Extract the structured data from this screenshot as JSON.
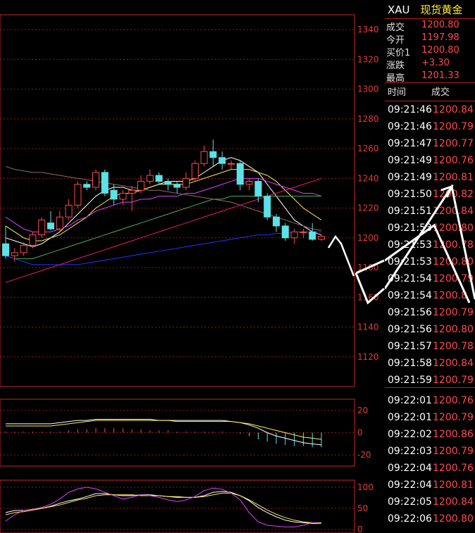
{
  "header": {
    "symbol": "XAU",
    "name": "现货黄金"
  },
  "quote": [
    {
      "label": "成交",
      "value": "1200.80"
    },
    {
      "label": "今开",
      "value": "1197.98"
    },
    {
      "label": "买价1",
      "value": "1200.80"
    },
    {
      "label": "涨跌",
      "value": "+3.30"
    },
    {
      "label": "最高",
      "value": "1201.33"
    }
  ],
  "ticks_header": {
    "time": "时间",
    "price": "成交"
  },
  "ticks": [
    {
      "time": "09:21:46",
      "price": "1200.84"
    },
    {
      "time": "09:21:46",
      "price": "1200.79"
    },
    {
      "time": "09:21:47",
      "price": "1200.77"
    },
    {
      "time": "09:21:49",
      "price": "1200.76"
    },
    {
      "time": "09:21:49",
      "price": "1200.81"
    },
    {
      "time": "09:21:50",
      "price": "1200.82"
    },
    {
      "time": "09:21:51",
      "price": "1200.84"
    },
    {
      "time": "09:21:53",
      "price": "1200.80"
    },
    {
      "time": "09:21:53",
      "price": "1200.78"
    },
    {
      "time": "09:21:53",
      "price": "1200.80"
    },
    {
      "time": "09:21:54",
      "price": "1200.79"
    },
    {
      "time": "09:21:54",
      "price": "1200.8"
    },
    {
      "time": "09:21:56",
      "price": "1200.79"
    },
    {
      "time": "09:21:56",
      "price": "1200.80"
    },
    {
      "time": "09:21:57",
      "price": "1200.78"
    },
    {
      "time": "09:21:58",
      "price": "1200.84"
    },
    {
      "time": "09:21:59",
      "price": "1200.79"
    },
    {
      "time": "09:22:01",
      "price": "1200.76"
    },
    {
      "time": "09:22:01",
      "price": "1200.79"
    },
    {
      "time": "09:22:02",
      "price": "1200.86"
    },
    {
      "time": "09:22:03",
      "price": "1200.79"
    },
    {
      "time": "09:22:04",
      "price": "1200.76"
    },
    {
      "time": "09:22:04",
      "price": "1200.81"
    },
    {
      "time": "09:22:05",
      "price": "1200.84"
    },
    {
      "time": "09:22:06",
      "price": "1200.80"
    }
  ],
  "chart_data": [
    {
      "type": "candlestick",
      "ylim": [
        1100,
        1350
      ],
      "y_ticks": [
        "1340",
        "1320",
        "1300",
        "1280",
        "1260",
        "1240",
        "1220",
        "1200",
        "1180",
        "1160",
        "1140",
        "1120"
      ],
      "candles": [
        {
          "o": 1196,
          "h": 1208,
          "l": 1186,
          "c": 1188
        },
        {
          "o": 1188,
          "h": 1193,
          "l": 1184,
          "c": 1190
        },
        {
          "o": 1190,
          "h": 1197,
          "l": 1188,
          "c": 1195
        },
        {
          "o": 1195,
          "h": 1204,
          "l": 1193,
          "c": 1202
        },
        {
          "o": 1202,
          "h": 1214,
          "l": 1200,
          "c": 1212
        },
        {
          "o": 1210,
          "h": 1218,
          "l": 1205,
          "c": 1206
        },
        {
          "o": 1206,
          "h": 1218,
          "l": 1204,
          "c": 1214
        },
        {
          "o": 1214,
          "h": 1226,
          "l": 1212,
          "c": 1222
        },
        {
          "o": 1222,
          "h": 1238,
          "l": 1220,
          "c": 1236
        },
        {
          "o": 1236,
          "h": 1238,
          "l": 1232,
          "c": 1234
        },
        {
          "o": 1234,
          "h": 1246,
          "l": 1232,
          "c": 1244
        },
        {
          "o": 1244,
          "h": 1246,
          "l": 1228,
          "c": 1230
        },
        {
          "o": 1232,
          "h": 1236,
          "l": 1222,
          "c": 1226
        },
        {
          "o": 1226,
          "h": 1232,
          "l": 1222,
          "c": 1230
        },
        {
          "o": 1230,
          "h": 1235,
          "l": 1218,
          "c": 1232
        },
        {
          "o": 1232,
          "h": 1242,
          "l": 1230,
          "c": 1238
        },
        {
          "o": 1238,
          "h": 1246,
          "l": 1236,
          "c": 1242
        },
        {
          "o": 1242,
          "h": 1244,
          "l": 1236,
          "c": 1238
        },
        {
          "o": 1238,
          "h": 1240,
          "l": 1232,
          "c": 1236
        },
        {
          "o": 1236,
          "h": 1238,
          "l": 1230,
          "c": 1234
        },
        {
          "o": 1234,
          "h": 1244,
          "l": 1232,
          "c": 1240
        },
        {
          "o": 1240,
          "h": 1252,
          "l": 1238,
          "c": 1250
        },
        {
          "o": 1250,
          "h": 1262,
          "l": 1248,
          "c": 1258
        },
        {
          "o": 1258,
          "h": 1266,
          "l": 1248,
          "c": 1254
        },
        {
          "o": 1254,
          "h": 1258,
          "l": 1246,
          "c": 1250
        },
        {
          "o": 1250,
          "h": 1252,
          "l": 1246,
          "c": 1250
        },
        {
          "o": 1250,
          "h": 1252,
          "l": 1232,
          "c": 1236
        },
        {
          "o": 1236,
          "h": 1240,
          "l": 1232,
          "c": 1238
        },
        {
          "o": 1238,
          "h": 1240,
          "l": 1224,
          "c": 1228
        },
        {
          "o": 1228,
          "h": 1230,
          "l": 1212,
          "c": 1214
        },
        {
          "o": 1214,
          "h": 1216,
          "l": 1204,
          "c": 1208
        },
        {
          "o": 1208,
          "h": 1210,
          "l": 1198,
          "c": 1200
        },
        {
          "o": 1200,
          "h": 1206,
          "l": 1196,
          "c": 1204
        },
        {
          "o": 1204,
          "h": 1206,
          "l": 1200,
          "c": 1204
        },
        {
          "o": 1204,
          "h": 1210,
          "l": 1198,
          "c": 1199
        },
        {
          "o": 1199,
          "h": 1202,
          "l": 1198,
          "c": 1201
        }
      ],
      "ma_lines": [
        {
          "color": "#ffffff",
          "values": [
            1200,
            1198,
            1196,
            1194,
            1196,
            1200,
            1204,
            1210,
            1216,
            1222,
            1228,
            1232,
            1234,
            1234,
            1232,
            1232,
            1234,
            1236,
            1238,
            1238,
            1238,
            1240,
            1244,
            1248,
            1252,
            1254,
            1252,
            1248,
            1244,
            1236,
            1228,
            1220,
            1212,
            1208,
            1204,
            1202
          ]
        },
        {
          "color": "#ffee58",
          "values": [
            1208,
            1204,
            1200,
            1198,
            1198,
            1200,
            1202,
            1206,
            1210,
            1214,
            1220,
            1224,
            1228,
            1230,
            1230,
            1232,
            1234,
            1236,
            1236,
            1236,
            1236,
            1238,
            1240,
            1242,
            1244,
            1246,
            1246,
            1246,
            1244,
            1242,
            1238,
            1232,
            1226,
            1220,
            1216,
            1212
          ]
        },
        {
          "color": "#e040fb",
          "values": [
            1214,
            1210,
            1206,
            1204,
            1204,
            1204,
            1206,
            1208,
            1212,
            1214,
            1218,
            1220,
            1222,
            1224,
            1224,
            1226,
            1226,
            1228,
            1228,
            1228,
            1230,
            1230,
            1232,
            1234,
            1236,
            1238,
            1240,
            1240,
            1240,
            1238,
            1236,
            1234,
            1232,
            1230,
            1230,
            1228
          ]
        },
        {
          "color": "#4caf50",
          "values": [
            1188,
            1186,
            1186,
            1186,
            1188,
            1190,
            1192,
            1194,
            1196,
            1198,
            1200,
            1202,
            1204,
            1206,
            1208,
            1210,
            1212,
            1214,
            1216,
            1218,
            1220,
            1222,
            1224,
            1226,
            1226,
            1228,
            1228,
            1228,
            1228,
            1228,
            1228,
            1228,
            1228,
            1228,
            1228,
            1228
          ]
        },
        {
          "color": "#8d6e63",
          "values": [
            1248,
            1246,
            1245,
            1244,
            1244,
            1243,
            1242,
            1241,
            1240,
            1239,
            1238,
            1237,
            1236,
            1235,
            1234,
            1233,
            1232,
            1232,
            1231,
            1230,
            1229,
            1228,
            1227,
            1226,
            1225,
            1224,
            1222,
            1220,
            1218,
            1216,
            1214,
            1212,
            1210,
            1208,
            1206,
            1205
          ]
        },
        {
          "color": "#2233ff",
          "values": [
            1188,
            1186,
            1184,
            1182,
            1182,
            1182,
            1182,
            1182,
            1182,
            1183,
            1184,
            1185,
            1186,
            1187,
            1188,
            1189,
            1190,
            1191,
            1192,
            1193,
            1194,
            1195,
            1196,
            1197,
            1198,
            1199,
            1200,
            1201,
            1202,
            1202,
            1203,
            1203,
            1204,
            1204,
            1204,
            1204
          ]
        },
        {
          "color": "#e91e63",
          "values": [
            1170,
            1172,
            1174,
            1176,
            1178,
            1180,
            1182,
            1184,
            1186,
            1188,
            1190,
            1192,
            1194,
            1196,
            1198,
            1200,
            1202,
            1204,
            1206,
            1208,
            1210,
            1212,
            1214,
            1216,
            1218,
            1220,
            1222,
            1224,
            1226,
            1228,
            1230,
            1232,
            1234,
            1236,
            1238,
            1240
          ]
        }
      ]
    },
    {
      "type": "bar",
      "y_ticks": [
        "20",
        "0",
        "-20"
      ],
      "ylim": [
        -30,
        30
      ],
      "values": [
        1,
        1,
        1,
        1,
        1,
        1,
        1,
        2,
        3,
        3,
        4,
        4,
        4,
        4,
        3,
        3,
        2,
        2,
        2,
        1,
        1,
        1,
        1,
        1,
        1,
        0,
        -1,
        -3,
        -6,
        -8,
        -10,
        -11,
        -12,
        -12,
        -13,
        -13
      ],
      "lines": [
        {
          "color": "#ffffff",
          "values": [
            8,
            8,
            8,
            8,
            8,
            8,
            9,
            10,
            11,
            11,
            12,
            12,
            12,
            12,
            12,
            12,
            12,
            11,
            11,
            11,
            11,
            11,
            11,
            11,
            11,
            10,
            9,
            7,
            4,
            0,
            -3,
            -5,
            -7,
            -9,
            -10,
            -11
          ]
        },
        {
          "color": "#ffee58",
          "values": [
            6,
            6,
            6,
            6,
            6,
            6,
            7,
            8,
            9,
            10,
            11,
            11,
            11,
            11,
            11,
            11,
            11,
            11,
            11,
            10,
            10,
            10,
            10,
            10,
            10,
            10,
            9,
            8,
            6,
            4,
            2,
            0,
            -2,
            -4,
            -5,
            -6
          ]
        }
      ]
    },
    {
      "type": "line",
      "y_ticks": [
        "100",
        "50",
        "0"
      ],
      "ylim": [
        0,
        110
      ],
      "lines": [
        {
          "color": "#ffffff",
          "values": [
            40,
            45,
            45,
            48,
            50,
            55,
            62,
            68,
            72,
            78,
            85,
            85,
            82,
            80,
            80,
            82,
            82,
            80,
            78,
            76,
            76,
            76,
            80,
            88,
            90,
            88,
            80,
            68,
            52,
            40,
            30,
            22,
            18,
            16,
            14,
            14
          ]
        },
        {
          "color": "#ffee58",
          "values": [
            35,
            40,
            42,
            46,
            50,
            54,
            58,
            64,
            70,
            74,
            80,
            82,
            82,
            82,
            82,
            80,
            80,
            80,
            78,
            78,
            76,
            76,
            78,
            82,
            86,
            86,
            80,
            70,
            58,
            46,
            36,
            28,
            22,
            18,
            16,
            16
          ]
        },
        {
          "color": "#e040fb",
          "values": [
            20,
            35,
            45,
            48,
            52,
            60,
            72,
            88,
            96,
            100,
            96,
            88,
            80,
            72,
            76,
            82,
            80,
            76,
            70,
            66,
            70,
            78,
            92,
            98,
            95,
            86,
            70,
            40,
            18,
            10,
            8,
            6,
            6,
            10,
            16,
            14
          ]
        }
      ]
    }
  ]
}
